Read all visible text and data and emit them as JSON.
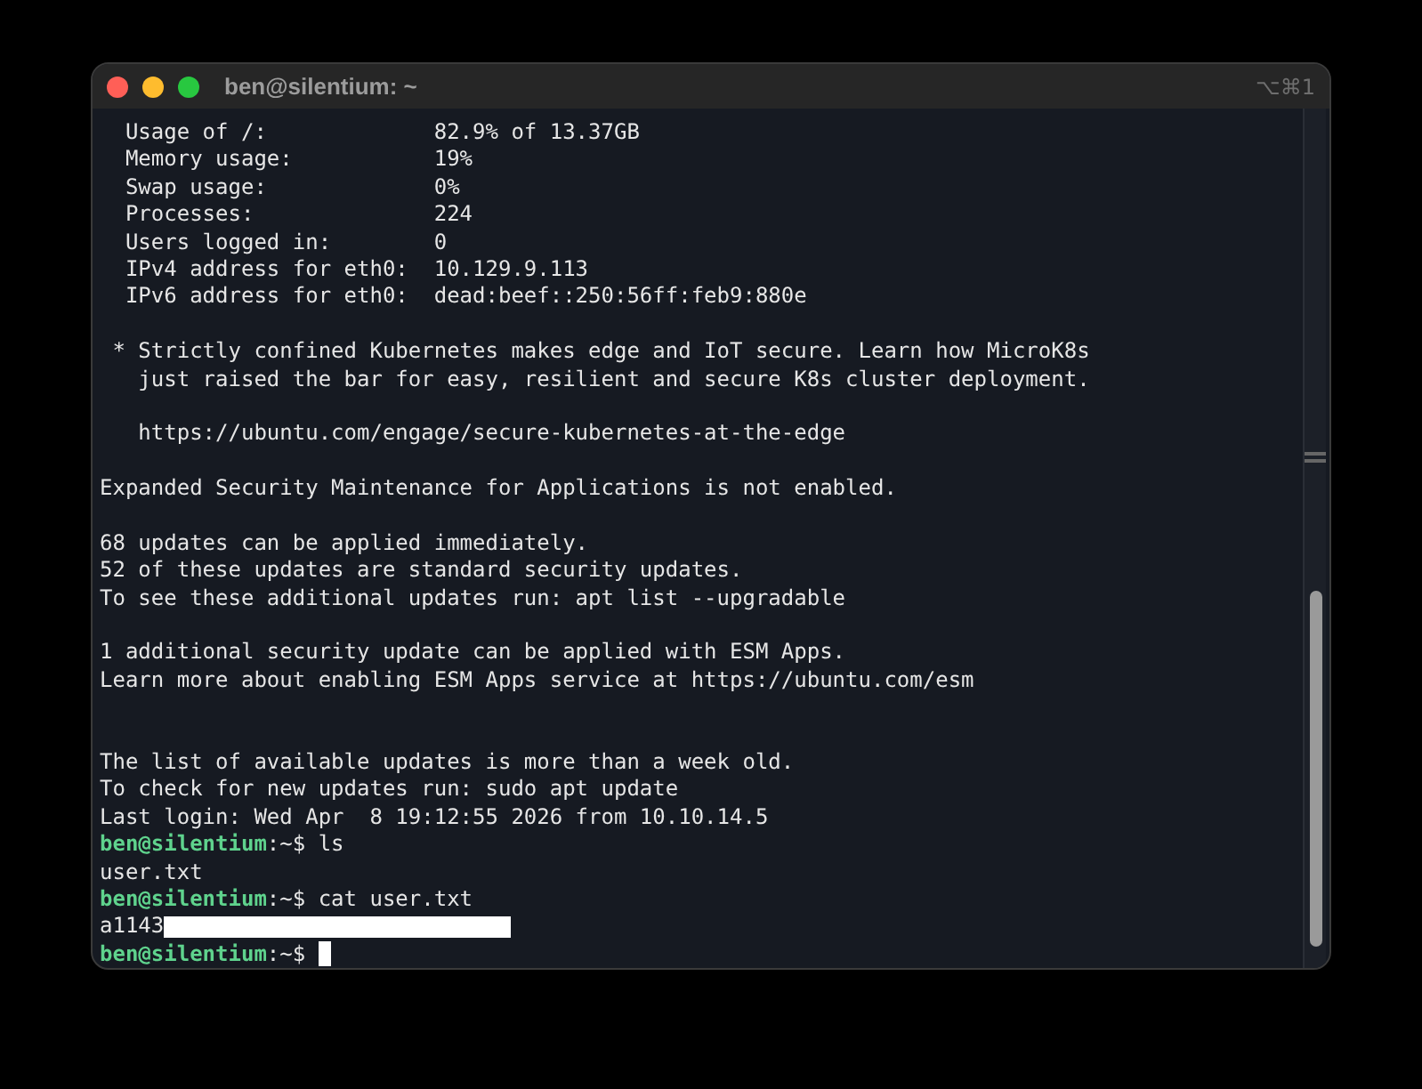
{
  "window": {
    "title": "ben@silentium: ~",
    "shortcut": "⌥⌘1"
  },
  "terminal": {
    "lines": [
      {
        "kind": "output",
        "text": "  Usage of /:             82.9% of 13.37GB"
      },
      {
        "kind": "output",
        "text": "  Memory usage:           19%"
      },
      {
        "kind": "output",
        "text": "  Swap usage:             0%"
      },
      {
        "kind": "output",
        "text": "  Processes:              224"
      },
      {
        "kind": "output",
        "text": "  Users logged in:        0"
      },
      {
        "kind": "output",
        "text": "  IPv4 address for eth0:  10.129.9.113"
      },
      {
        "kind": "output",
        "text": "  IPv6 address for eth0:  dead:beef::250:56ff:feb9:880e"
      },
      {
        "kind": "blank"
      },
      {
        "kind": "output",
        "text": " * Strictly confined Kubernetes makes edge and IoT secure. Learn how MicroK8s"
      },
      {
        "kind": "output",
        "text": "   just raised the bar for easy, resilient and secure K8s cluster deployment."
      },
      {
        "kind": "blank"
      },
      {
        "kind": "output",
        "text": "   https://ubuntu.com/engage/secure-kubernetes-at-the-edge"
      },
      {
        "kind": "blank"
      },
      {
        "kind": "output",
        "text": "Expanded Security Maintenance for Applications is not enabled."
      },
      {
        "kind": "blank"
      },
      {
        "kind": "output",
        "text": "68 updates can be applied immediately."
      },
      {
        "kind": "output",
        "text": "52 of these updates are standard security updates."
      },
      {
        "kind": "output",
        "text": "To see these additional updates run: apt list --upgradable"
      },
      {
        "kind": "blank"
      },
      {
        "kind": "output",
        "text": "1 additional security update can be applied with ESM Apps."
      },
      {
        "kind": "output",
        "text": "Learn more about enabling ESM Apps service at https://ubuntu.com/esm"
      },
      {
        "kind": "blank"
      },
      {
        "kind": "blank"
      },
      {
        "kind": "output",
        "text": "The list of available updates is more than a week old."
      },
      {
        "kind": "output",
        "text": "To check for new updates run: sudo apt update"
      },
      {
        "kind": "output",
        "text": "Last login: Wed Apr  8 19:12:55 2026 from 10.10.14.5"
      },
      {
        "kind": "prompt",
        "user": "ben@silentium",
        "path": ":~$",
        "command": "ls"
      },
      {
        "kind": "output",
        "text": "user.txt"
      },
      {
        "kind": "prompt",
        "user": "ben@silentium",
        "path": ":~$",
        "command": "cat user.txt"
      },
      {
        "kind": "output",
        "text": "a1143",
        "redacted": true
      },
      {
        "kind": "prompt",
        "user": "ben@silentium",
        "path": ":~$",
        "cursor": true
      }
    ]
  }
}
